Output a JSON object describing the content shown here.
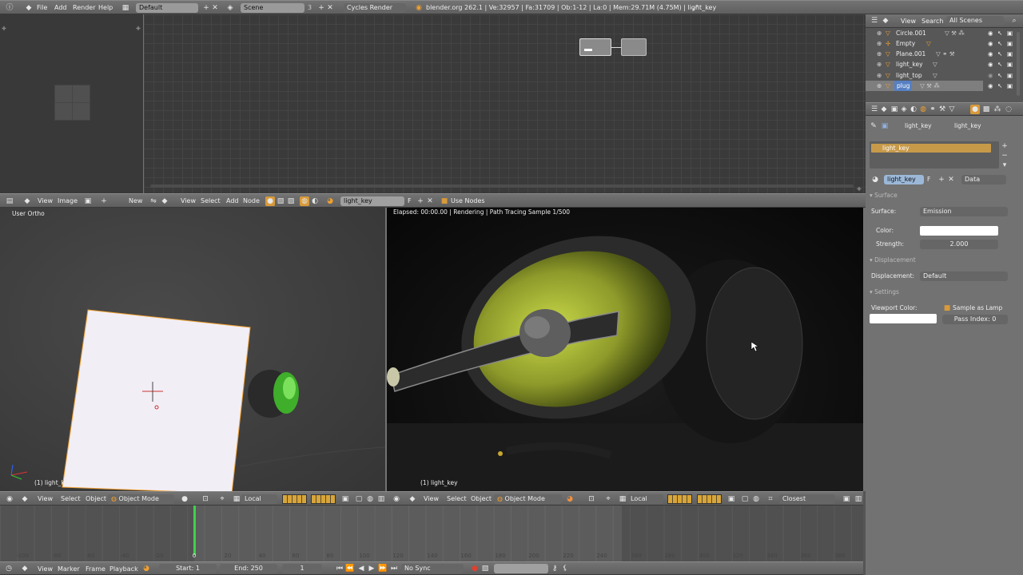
{
  "info_header": {
    "menus": [
      "File",
      "Add",
      "Render",
      "Help"
    ],
    "screen_layout": "Default",
    "scene": "Scene",
    "scene_count": "3",
    "render_engine": "Cycles Render",
    "stats": "blender.org 262.1 | Ve:32957 | Fa:31709 | Ob:1-12 | La:0 | Mem:29.71M (4.75M) | light_key"
  },
  "image_editor_header": {
    "menus": [
      "View",
      "Image"
    ],
    "new_label": "New"
  },
  "node_editor": {
    "menus": [
      "View",
      "Select",
      "Add",
      "Node"
    ],
    "material": "light_key",
    "fake_user": "F",
    "use_nodes": "Use Nodes"
  },
  "outliner": {
    "header": {
      "view": "View",
      "search": "Search",
      "filter": "All Scenes"
    },
    "items": [
      {
        "name": "Circle.001"
      },
      {
        "name": "Empty"
      },
      {
        "name": "Plane.001"
      },
      {
        "name": "light_key"
      },
      {
        "name": "light_top"
      },
      {
        "name": "plug"
      }
    ]
  },
  "properties": {
    "breadcrumb": [
      "light_key",
      "light_key"
    ],
    "material_slot": "light_key",
    "datablock": "light_key",
    "fake_user": "F",
    "link": "Data",
    "surface_panel": "Surface",
    "surface_label": "Surface:",
    "surface_value": "Emission",
    "color_label": "Color:",
    "color_value": "#ffffff",
    "strength_label": "Strength:",
    "strength_value": "2.000",
    "displacement_panel": "Displacement",
    "displacement_label": "Displacement:",
    "displacement_value": "Default",
    "settings_panel": "Settings",
    "viewport_color_label": "Viewport Color:",
    "sample_as_lamp": "Sample as Lamp",
    "pass_index": "Pass Index: 0"
  },
  "viewport_left": {
    "title": "User Ortho",
    "object_label": "(1) light_key",
    "menus": [
      "View",
      "Select",
      "Object"
    ],
    "mode": "Object Mode",
    "pivot": "Local"
  },
  "viewport_right": {
    "status": "Elapsed: 00:00.00 | Rendering | Path Tracing Sample 1/500",
    "object_label": "(1) light_key",
    "menus": [
      "View",
      "Select",
      "Object"
    ],
    "mode": "Object Mode",
    "pivot": "Local",
    "snap": "Closest"
  },
  "timeline": {
    "ticks": [
      "-100",
      "-80",
      "-60",
      "-40",
      "-20",
      "0",
      "20",
      "40",
      "60",
      "80",
      "100",
      "120",
      "140",
      "160",
      "180",
      "200",
      "220",
      "240",
      "260",
      "280",
      "300",
      "320",
      "340",
      "360",
      "380"
    ],
    "current_frame_marker": "0",
    "menus": [
      "View",
      "Marker",
      "Frame",
      "Playback"
    ],
    "start": "Start: 1",
    "end": "End: 250",
    "current": "1",
    "sync": "No Sync"
  },
  "colors": {
    "accent": "#d89a3a",
    "selection": "#5680c2",
    "active_row": "#c79a4a",
    "playhead": "#3fd14a"
  }
}
